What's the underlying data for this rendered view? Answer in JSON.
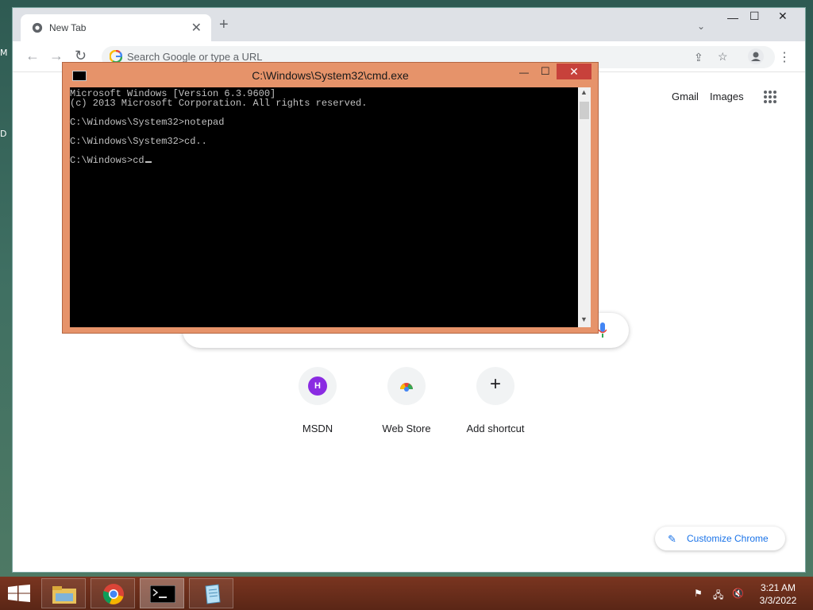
{
  "desktop": {
    "edge_chars": [
      "M",
      "D"
    ]
  },
  "chrome": {
    "tab_title": "New Tab",
    "omnibox_placeholder": "Search Google or type a URL",
    "links": {
      "gmail": "Gmail",
      "images": "Images"
    },
    "shortcuts": [
      {
        "label": "MSDN",
        "badge": "H"
      },
      {
        "label": "Web Store"
      },
      {
        "label": "Add shortcut",
        "symbol": "+"
      }
    ],
    "customize_label": "Customize Chrome"
  },
  "cmd": {
    "title": "C:\\Windows\\System32\\cmd.exe",
    "lines": [
      "Microsoft Windows [Version 6.3.9600]",
      "(c) 2013 Microsoft Corporation. All rights reserved.",
      "",
      "C:\\Windows\\System32>notepad",
      "",
      "C:\\Windows\\System32>cd..",
      "",
      "C:\\Windows>cd"
    ]
  },
  "taskbar": {
    "time": "3:21 AM",
    "date": "3/3/2022"
  },
  "colors": {
    "cmd_frame": "#e6936a",
    "close_red": "#c7413b",
    "taskbar": "#6b2e1b",
    "link_blue": "#1a73e8"
  }
}
